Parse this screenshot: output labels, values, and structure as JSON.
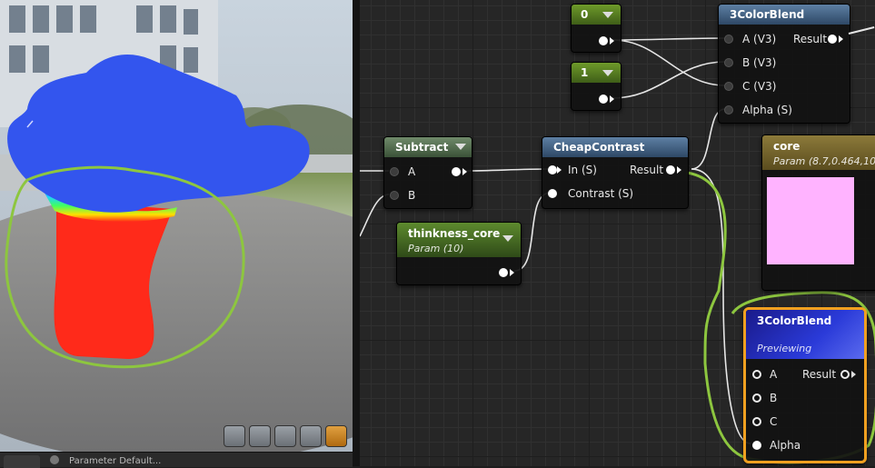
{
  "viewport": {
    "toolbar_icons": [
      "cylinder-icon",
      "sphere-icon",
      "plane-icon",
      "cube-icon",
      "teapot-icon"
    ]
  },
  "bottom_tabs": {
    "details_tab": "",
    "parameter_defaults_tab": "Parameter Default..."
  },
  "nodes": {
    "const0": {
      "value": "0"
    },
    "const1": {
      "value": "1"
    },
    "blend_top": {
      "title": "3ColorBlend",
      "inputs": [
        "A (V3)",
        "B (V3)",
        "C (V3)",
        "Alpha (S)"
      ],
      "output": "Result"
    },
    "subtract": {
      "title": "Subtract",
      "inputs": [
        "A",
        "B"
      ]
    },
    "cheap_contrast": {
      "title": "CheapContrast",
      "inputs": [
        "In (S)",
        "Contrast (S)"
      ],
      "output": "Result"
    },
    "thickness": {
      "title": "thinkness_core",
      "subtitle": "Param (10)"
    },
    "core": {
      "title": "core",
      "subtitle": "Param (8.7,0.464,10,",
      "swatch_color": "#ffb3ff"
    },
    "blend_preview": {
      "title": "3ColorBlend",
      "subtitle": "Previewing",
      "inputs": [
        "A",
        "B",
        "C",
        "Alpha"
      ],
      "output": "Result"
    }
  },
  "colors": {
    "highlight_outline": "#8dc63f",
    "selected_border": "#f0a020",
    "preview_blue": "#3355ee",
    "preview_red": "#ff2a1a"
  }
}
